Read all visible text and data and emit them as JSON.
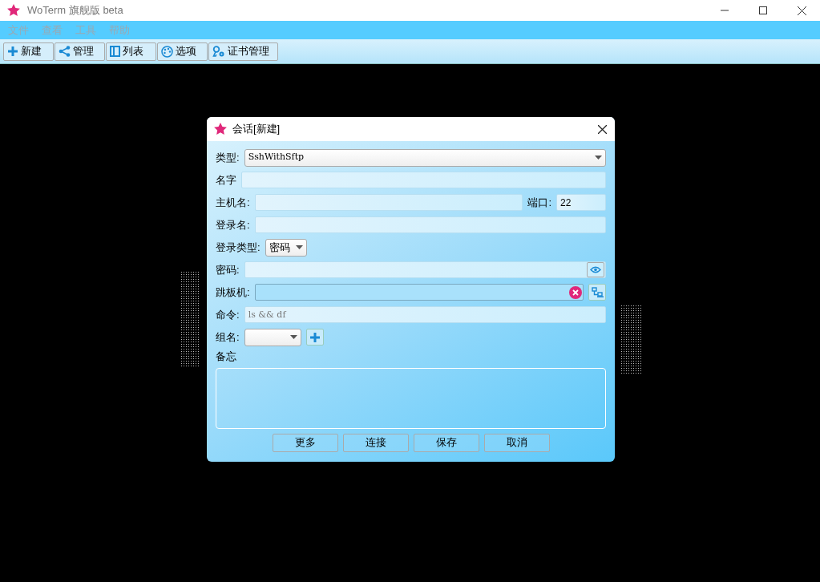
{
  "window": {
    "title": "WoTerm 旗舰版 beta"
  },
  "menu": [
    {
      "label": "文件",
      "disabled": true
    },
    {
      "label": "查看",
      "disabled": true
    },
    {
      "label": "工具",
      "disabled": true
    },
    {
      "label": "帮助",
      "disabled": true
    }
  ],
  "toolbar": [
    {
      "label": "新建",
      "kind": "plus"
    },
    {
      "label": "管理",
      "kind": "share"
    },
    {
      "label": "列表",
      "kind": "list"
    },
    {
      "label": "选项",
      "kind": "palette"
    },
    {
      "label": "证书管理",
      "kind": "key"
    }
  ],
  "dialog": {
    "title": "会话[新建]",
    "rows": [
      {
        "kind": "select",
        "label": "类型:",
        "value": "SshWithSftp"
      },
      {
        "kind": "text",
        "label": "名字"
      },
      {
        "kind": "host",
        "label": "主机名:",
        "port_label": "端口:",
        "port_value": "22"
      },
      {
        "kind": "text",
        "label": "登录名:"
      },
      {
        "kind": "small_select",
        "label": "登录类型:",
        "value": "密码"
      },
      {
        "kind": "password",
        "label": "密码:"
      },
      {
        "kind": "jump",
        "label": "跳板机:"
      },
      {
        "kind": "command",
        "label": "命令:",
        "placeholder": "ls && df"
      },
      {
        "kind": "group",
        "label": "组名:"
      }
    ],
    "memo_label": "备忘",
    "buttons": [
      "更多",
      "连接",
      "保存",
      "取消"
    ]
  }
}
